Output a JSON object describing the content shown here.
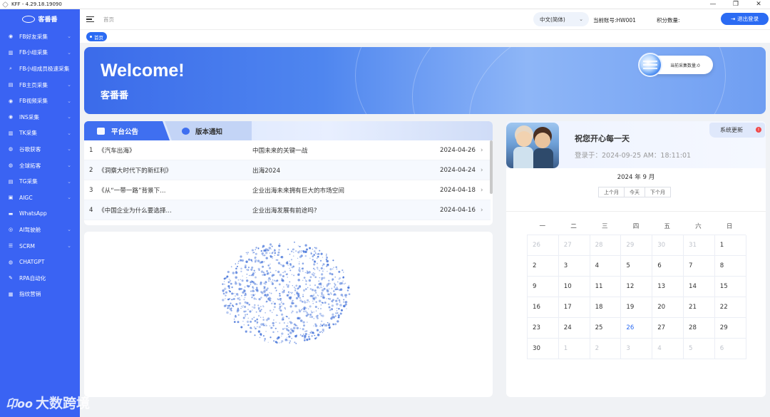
{
  "window": {
    "title": "KFF - 4.29.18.19090",
    "minimize": "—",
    "restore": "❐",
    "close": "✕"
  },
  "brand": {
    "name": "客番番"
  },
  "sidebar": {
    "items": [
      {
        "label": "FB好友采集",
        "icon": "◉",
        "icon_name": "database-icon",
        "has_children": true
      },
      {
        "label": "FB小组采集",
        "icon": "▥",
        "icon_name": "book-icon",
        "has_children": true
      },
      {
        "label": "FB小组成员极速采集",
        "icon": "⌕",
        "icon_name": "search-icon",
        "has_children": false
      },
      {
        "label": "FB主页采集",
        "icon": "▤",
        "icon_name": "page-icon",
        "has_children": true
      },
      {
        "label": "FB视频采集",
        "icon": "◉",
        "icon_name": "database-icon",
        "has_children": true
      },
      {
        "label": "INS采集",
        "icon": "◉",
        "icon_name": "radio-icon",
        "has_children": true
      },
      {
        "label": "TK采集",
        "icon": "▥",
        "icon_name": "book-icon",
        "has_children": true
      },
      {
        "label": "谷歌获客",
        "icon": "◍",
        "icon_name": "globe-icon",
        "has_children": true
      },
      {
        "label": "全球拓客",
        "icon": "◍",
        "icon_name": "globe-icon",
        "has_children": true
      },
      {
        "label": "TG采集",
        "icon": "▤",
        "icon_name": "list-icon",
        "has_children": true
      },
      {
        "label": "AIGC",
        "icon": "▣",
        "icon_name": "ai-icon",
        "has_children": true
      },
      {
        "label": "WhatsApp",
        "icon": "▬",
        "icon_name": "chat-icon",
        "has_children": false
      },
      {
        "label": "AI驾驶舱",
        "icon": "◎",
        "icon_name": "cockpit-icon",
        "has_children": true
      },
      {
        "label": "SCRM",
        "icon": "☰",
        "icon_name": "list-icon",
        "has_children": true
      },
      {
        "label": "CHATGPT",
        "icon": "◍",
        "icon_name": "globe-icon",
        "has_children": false
      },
      {
        "label": "RPA自动化",
        "icon": "✎",
        "icon_name": "edit-icon",
        "has_children": false
      },
      {
        "label": "指纹营销",
        "icon": "▦",
        "icon_name": "fingerprint-icon",
        "has_children": false
      }
    ]
  },
  "header": {
    "breadcrumb": "首页",
    "language": "中文(简体)",
    "account": "当前账号:HW001",
    "points": "积分数量:",
    "logout": "退出登录"
  },
  "tags": {
    "home": "首页"
  },
  "banner": {
    "welcome": "Welcome!",
    "name": "客番番",
    "collect_count": "当前采集数量:0"
  },
  "announcements": {
    "tab_platform": "平台公告",
    "tab_version": "版本通知",
    "rows": [
      {
        "idx": "1",
        "title": "《汽车出海》",
        "summary": "中国未来的关键一战",
        "date": "2024-04-26"
      },
      {
        "idx": "2",
        "title": "《洞察大时代下的新红利》",
        "summary": "出海2024",
        "date": "2024-04-24"
      },
      {
        "idx": "3",
        "title": "《从“一带一路”背景下...",
        "summary": "企业出海未来拥有巨大的市场空间",
        "date": "2024-04-18"
      },
      {
        "idx": "4",
        "title": "《中国企业为什么要选择...",
        "summary": "企业出海发展有前途吗?",
        "date": "2024-04-16"
      }
    ]
  },
  "user": {
    "greeting": "祝您开心每一天",
    "login_time": "登录于：2024-09-25 AM：18:11:01",
    "system_update": "系统更新",
    "update_badge": "!"
  },
  "calendar": {
    "title": "2024 年 9 月",
    "prev": "上个月",
    "today": "今天",
    "next": "下个月",
    "weekdays": [
      "一",
      "二",
      "三",
      "四",
      "五",
      "六",
      "日"
    ],
    "today_day": "26",
    "cells": [
      {
        "d": "26",
        "o": true
      },
      {
        "d": "27",
        "o": true
      },
      {
        "d": "28",
        "o": true
      },
      {
        "d": "29",
        "o": true
      },
      {
        "d": "30",
        "o": true
      },
      {
        "d": "31",
        "o": true
      },
      {
        "d": "1",
        "o": false
      },
      {
        "d": "2",
        "o": false
      },
      {
        "d": "3",
        "o": false
      },
      {
        "d": "4",
        "o": false
      },
      {
        "d": "5",
        "o": false
      },
      {
        "d": "6",
        "o": false
      },
      {
        "d": "7",
        "o": false
      },
      {
        "d": "8",
        "o": false
      },
      {
        "d": "9",
        "o": false
      },
      {
        "d": "10",
        "o": false
      },
      {
        "d": "11",
        "o": false
      },
      {
        "d": "12",
        "o": false
      },
      {
        "d": "13",
        "o": false
      },
      {
        "d": "14",
        "o": false
      },
      {
        "d": "15",
        "o": false
      },
      {
        "d": "16",
        "o": false
      },
      {
        "d": "17",
        "o": false
      },
      {
        "d": "18",
        "o": false
      },
      {
        "d": "19",
        "o": false
      },
      {
        "d": "20",
        "o": false
      },
      {
        "d": "21",
        "o": false
      },
      {
        "d": "22",
        "o": false
      },
      {
        "d": "23",
        "o": false
      },
      {
        "d": "24",
        "o": false
      },
      {
        "d": "25",
        "o": false
      },
      {
        "d": "26",
        "o": false
      },
      {
        "d": "27",
        "o": false
      },
      {
        "d": "28",
        "o": false
      },
      {
        "d": "29",
        "o": false
      },
      {
        "d": "30",
        "o": false
      },
      {
        "d": "1",
        "o": true
      },
      {
        "d": "2",
        "o": true
      },
      {
        "d": "3",
        "o": true
      },
      {
        "d": "4",
        "o": true
      },
      {
        "d": "5",
        "o": true
      },
      {
        "d": "6",
        "o": true
      }
    ]
  },
  "watermark": {
    "logo": "卬oo",
    "text": "大数跨境"
  },
  "colors": {
    "sidebar": "#3a63f3",
    "accent": "#2b6bf3",
    "badge": "#f04848",
    "particle": "#3f6fd8"
  }
}
